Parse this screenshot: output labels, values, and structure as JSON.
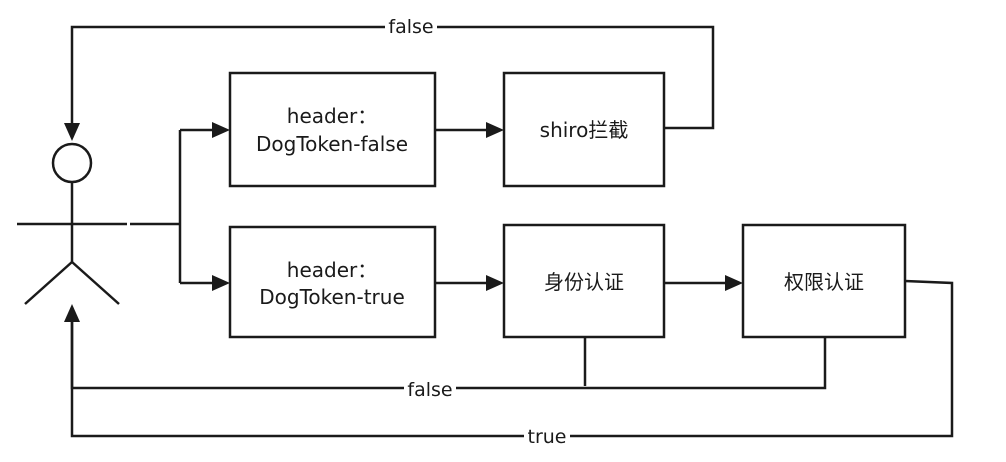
{
  "diagram": {
    "nodes": {
      "header_false": {
        "lines": [
          "header：",
          "DogToken-false"
        ]
      },
      "shiro": {
        "lines": [
          "shiro拦截"
        ]
      },
      "header_true": {
        "lines": [
          "header：",
          "DogToken-true"
        ]
      },
      "identity_auth": {
        "lines": [
          "身份认证"
        ]
      },
      "permission_auth": {
        "lines": [
          "权限认证"
        ]
      }
    },
    "edges": {
      "shiro_to_user": {
        "label": "false"
      },
      "auth_fail_to_user": {
        "label": "false"
      },
      "permission_to_user": {
        "label": "true"
      }
    }
  }
}
